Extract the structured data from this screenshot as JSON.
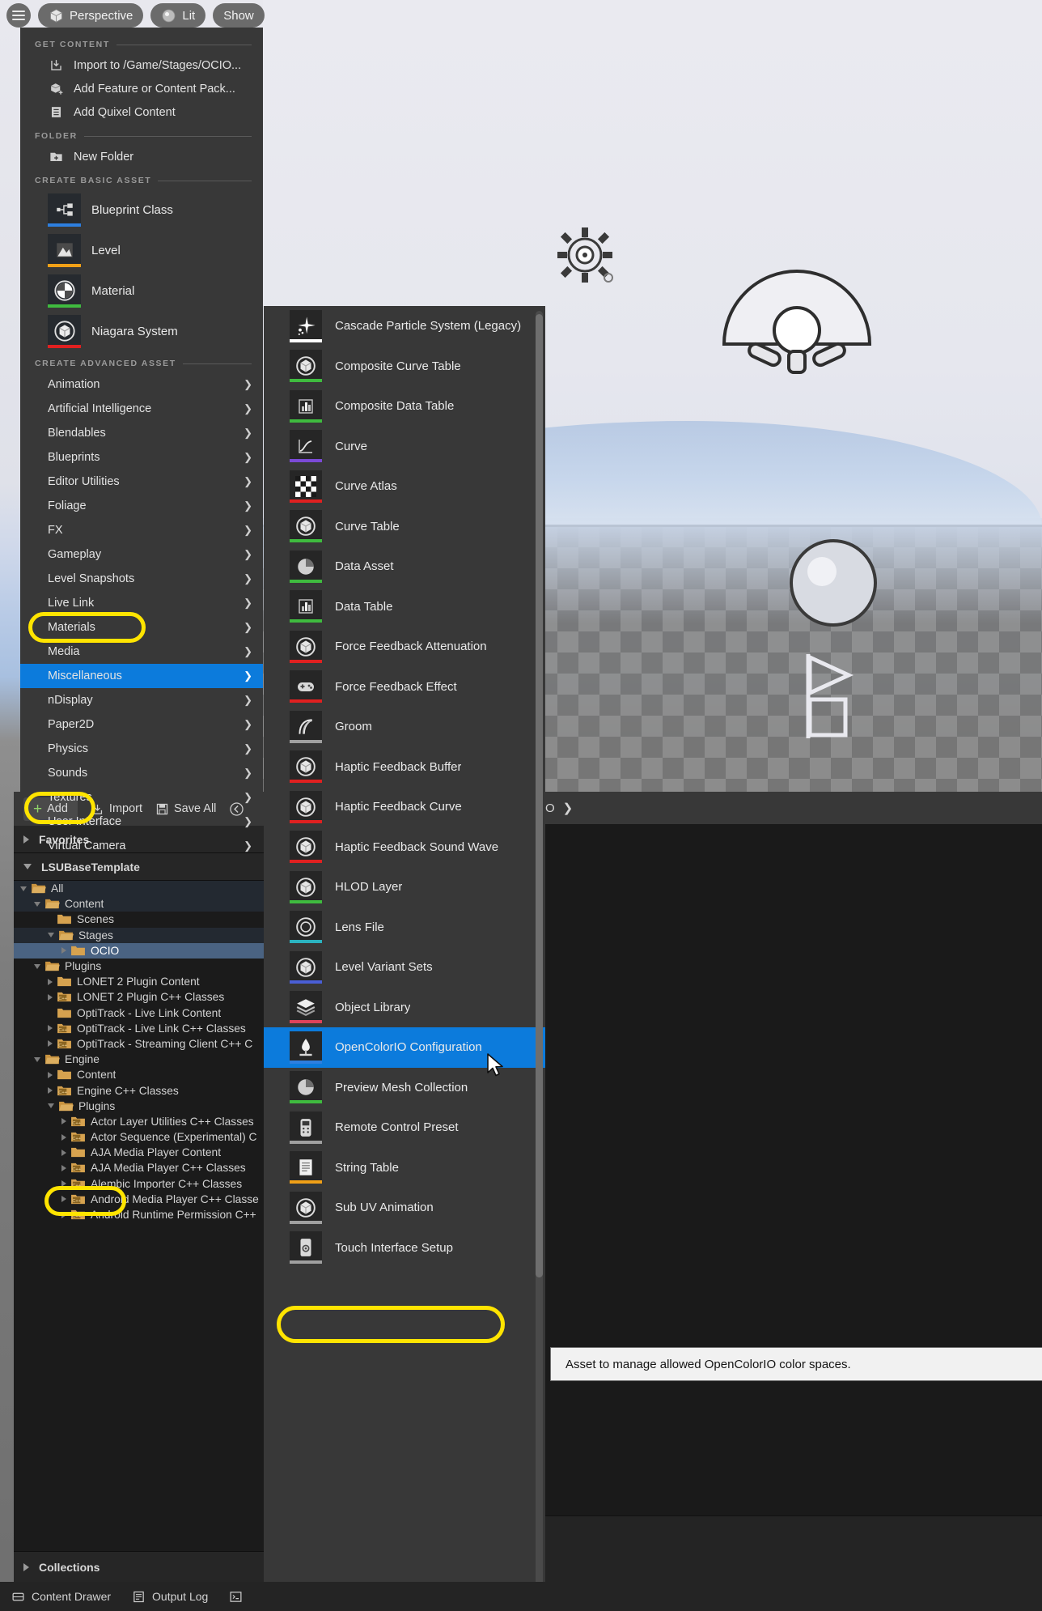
{
  "toolbar": {
    "menu_icon": "hamburger-icon",
    "perspective_label": "Perspective",
    "lit_label": "Lit",
    "show_label": "Show"
  },
  "add_menu": {
    "sections": [
      {
        "title": "GET CONTENT",
        "items": [
          {
            "label": "Import to /Game/Stages/OCIO...",
            "icon": "import-icon"
          },
          {
            "label": "Add Feature or Content Pack...",
            "icon": "package-icon"
          },
          {
            "label": "Add Quixel Content",
            "icon": "quixel-icon"
          }
        ]
      },
      {
        "title": "FOLDER",
        "items": [
          {
            "label": "New Folder",
            "icon": "new-folder-icon"
          }
        ]
      }
    ],
    "basic_section_title": "CREATE BASIC ASSET",
    "basic_assets": [
      {
        "label": "Blueprint Class",
        "icon": "blueprint-icon",
        "accent": "#2d7fe0"
      },
      {
        "label": "Level",
        "icon": "level-icon",
        "accent": "#f0a017"
      },
      {
        "label": "Material",
        "icon": "material-icon",
        "accent": "#3fbb3f"
      },
      {
        "label": "Niagara System",
        "icon": "niagara-icon",
        "accent": "#e02020"
      }
    ],
    "advanced_section_title": "CREATE ADVANCED ASSET",
    "advanced_items": [
      {
        "label": "Animation",
        "selected": false
      },
      {
        "label": "Artificial Intelligence",
        "selected": false
      },
      {
        "label": "Blendables",
        "selected": false
      },
      {
        "label": "Blueprints",
        "selected": false
      },
      {
        "label": "Editor Utilities",
        "selected": false
      },
      {
        "label": "Foliage",
        "selected": false
      },
      {
        "label": "FX",
        "selected": false
      },
      {
        "label": "Gameplay",
        "selected": false
      },
      {
        "label": "Level Snapshots",
        "selected": false
      },
      {
        "label": "Live Link",
        "selected": false
      },
      {
        "label": "Materials",
        "selected": false
      },
      {
        "label": "Media",
        "selected": false
      },
      {
        "label": "Miscellaneous",
        "selected": true
      },
      {
        "label": "nDisplay",
        "selected": false
      },
      {
        "label": "Paper2D",
        "selected": false
      },
      {
        "label": "Physics",
        "selected": false
      },
      {
        "label": "Sounds",
        "selected": false
      },
      {
        "label": "Textures",
        "selected": false
      },
      {
        "label": "User Interface",
        "selected": false
      },
      {
        "label": "Virtual Camera",
        "selected": false
      }
    ],
    "submenu_arrow": "chevron-right-icon"
  },
  "submenu": {
    "items": [
      {
        "label": "Cascade Particle System (Legacy)",
        "icon": "particle-icon",
        "accent": "#ffffff",
        "selected": false
      },
      {
        "label": "Composite Curve Table",
        "icon": "sphere-icon",
        "accent": "#3fbb3f",
        "selected": false
      },
      {
        "label": "Composite Data Table",
        "icon": "bars-icon",
        "accent": "#3fbb3f",
        "selected": false
      },
      {
        "label": "Curve",
        "icon": "curve-icon",
        "accent": "#7b4ad6",
        "selected": false
      },
      {
        "label": "Curve Atlas",
        "icon": "checker-icon",
        "accent": "#e02020",
        "selected": false
      },
      {
        "label": "Curve Table",
        "icon": "sphere-icon",
        "accent": "#3fbb3f",
        "selected": false
      },
      {
        "label": "Data Asset",
        "icon": "pie-icon",
        "accent": "#3fbb3f",
        "selected": false
      },
      {
        "label": "Data Table",
        "icon": "bars-icon",
        "accent": "#3fbb3f",
        "selected": false
      },
      {
        "label": "Force Feedback Attenuation",
        "icon": "sphere-icon",
        "accent": "#e02020",
        "selected": false
      },
      {
        "label": "Force Feedback Effect",
        "icon": "gamepad-icon",
        "accent": "#e02020",
        "selected": false
      },
      {
        "label": "Groom",
        "icon": "groom-icon",
        "accent": "#a0a0a0",
        "selected": false
      },
      {
        "label": "Haptic Feedback Buffer",
        "icon": "sphere-icon",
        "accent": "#e02020",
        "selected": false
      },
      {
        "label": "Haptic Feedback Curve",
        "icon": "sphere-icon",
        "accent": "#e02020",
        "selected": false
      },
      {
        "label": "Haptic Feedback Sound Wave",
        "icon": "sphere-icon",
        "accent": "#e02020",
        "selected": false
      },
      {
        "label": "HLOD Layer",
        "icon": "sphere-icon",
        "accent": "#3fbb3f",
        "selected": false
      },
      {
        "label": "Lens File",
        "icon": "lens-icon",
        "accent": "#2bb3c0",
        "selected": false
      },
      {
        "label": "Level Variant Sets",
        "icon": "sphere-icon",
        "accent": "#4a5fd6",
        "selected": false
      },
      {
        "label": "Object Library",
        "icon": "layers-icon",
        "accent": "#e0425a",
        "selected": false
      },
      {
        "label": "OpenColorIO Configuration",
        "icon": "ocio-icon",
        "accent": "#2d7fe0",
        "selected": true
      },
      {
        "label": "Preview Mesh Collection",
        "icon": "pie-icon",
        "accent": "#3fbb3f",
        "selected": false
      },
      {
        "label": "Remote Control Preset",
        "icon": "remote-icon",
        "accent": "#a0a0a0",
        "selected": false
      },
      {
        "label": "String Table",
        "icon": "string-icon",
        "accent": "#f0a017",
        "selected": false
      },
      {
        "label": "Sub UV Animation",
        "icon": "sphere-icon",
        "accent": "#a0a0a0",
        "selected": false
      },
      {
        "label": "Touch Interface Setup",
        "icon": "touch-icon",
        "accent": "#a0a0a0",
        "selected": false
      }
    ]
  },
  "tooltip": {
    "text": "Asset to manage allowed OpenColorIO color spaces."
  },
  "content_browser": {
    "toolbar": {
      "add_label": "Add",
      "import_label": "Import",
      "save_all_label": "Save All",
      "add_icon": "plus-icon",
      "import_icon": "import-icon",
      "save_icon": "save-icon",
      "back_icon": "back-arrow-icon"
    },
    "favorites_label": "Favorites",
    "project_label": "LSUBaseTemplate",
    "collections_label": "Collections",
    "tree": [
      {
        "label": "All",
        "indent": 0,
        "state": "down",
        "icon": "folder-open-icon",
        "selected": false,
        "alt": true
      },
      {
        "label": "Content",
        "indent": 1,
        "state": "down",
        "icon": "folder-open-icon",
        "selected": false,
        "alt": true
      },
      {
        "label": "Scenes",
        "indent": 2,
        "state": "none",
        "icon": "folder-icon",
        "selected": false,
        "alt": false
      },
      {
        "label": "Stages",
        "indent": 2,
        "state": "down",
        "icon": "folder-open-icon",
        "selected": false,
        "alt": true
      },
      {
        "label": "OCIO",
        "indent": 3,
        "state": "right",
        "icon": "folder-icon",
        "selected": true,
        "alt": false
      },
      {
        "label": "Plugins",
        "indent": 1,
        "state": "down",
        "icon": "folder-open-icon",
        "selected": false,
        "alt": false
      },
      {
        "label": "LONET 2 Plugin Content",
        "indent": 2,
        "state": "right",
        "icon": "folder-icon",
        "selected": false,
        "alt": false
      },
      {
        "label": "LONET 2 Plugin C++ Classes",
        "indent": 2,
        "state": "right",
        "icon": "cpp-folder-icon",
        "selected": false,
        "alt": false
      },
      {
        "label": "OptiTrack - Live Link Content",
        "indent": 2,
        "state": "none",
        "icon": "folder-icon",
        "selected": false,
        "alt": false
      },
      {
        "label": "OptiTrack - Live Link C++ Classes",
        "indent": 2,
        "state": "right",
        "icon": "cpp-folder-icon",
        "selected": false,
        "alt": false
      },
      {
        "label": "OptiTrack - Streaming Client C++ C",
        "indent": 2,
        "state": "right",
        "icon": "cpp-folder-icon",
        "selected": false,
        "alt": false
      },
      {
        "label": "Engine",
        "indent": 1,
        "state": "down",
        "icon": "folder-open-icon",
        "selected": false,
        "alt": false
      },
      {
        "label": "Content",
        "indent": 2,
        "state": "right",
        "icon": "folder-icon",
        "selected": false,
        "alt": false
      },
      {
        "label": "Engine C++ Classes",
        "indent": 2,
        "state": "right",
        "icon": "cpp-folder-icon",
        "selected": false,
        "alt": false
      },
      {
        "label": "Plugins",
        "indent": 2,
        "state": "down",
        "icon": "folder-open-icon",
        "selected": false,
        "alt": false
      },
      {
        "label": "Actor Layer Utilities C++ Classes",
        "indent": 3,
        "state": "right",
        "icon": "cpp-folder-icon",
        "selected": false,
        "alt": false
      },
      {
        "label": "Actor Sequence (Experimental) C",
        "indent": 3,
        "state": "right",
        "icon": "cpp-folder-icon",
        "selected": false,
        "alt": false
      },
      {
        "label": "AJA Media Player Content",
        "indent": 3,
        "state": "right",
        "icon": "folder-icon",
        "selected": false,
        "alt": false
      },
      {
        "label": "AJA Media Player C++ Classes",
        "indent": 3,
        "state": "right",
        "icon": "cpp-folder-icon",
        "selected": false,
        "alt": false
      },
      {
        "label": "Alembic Importer C++ Classes",
        "indent": 3,
        "state": "right",
        "icon": "cpp-folder-icon",
        "selected": false,
        "alt": false
      },
      {
        "label": "Android Media Player C++ Classe",
        "indent": 3,
        "state": "right",
        "icon": "cpp-folder-icon",
        "selected": false,
        "alt": false
      },
      {
        "label": "Android Runtime Permission C++",
        "indent": 3,
        "state": "right",
        "icon": "cpp-folder-icon",
        "selected": false,
        "alt": false
      }
    ]
  },
  "right_panel": {
    "breadcrumb_tail": "O",
    "breadcrumb_chevron": "chevron-right-icon"
  },
  "status_bar": {
    "content_drawer_label": "Content Drawer",
    "output_log_label": "Output Log",
    "content_drawer_icon": "drawer-icon",
    "output_log_icon": "log-icon",
    "cmd_icon": "cmd-icon"
  },
  "colors": {
    "selection_blue": "#0c7bdc",
    "annotation_yellow": "#ffe400",
    "tree_selection": "#4a6382",
    "menu_bg": "#383838"
  }
}
